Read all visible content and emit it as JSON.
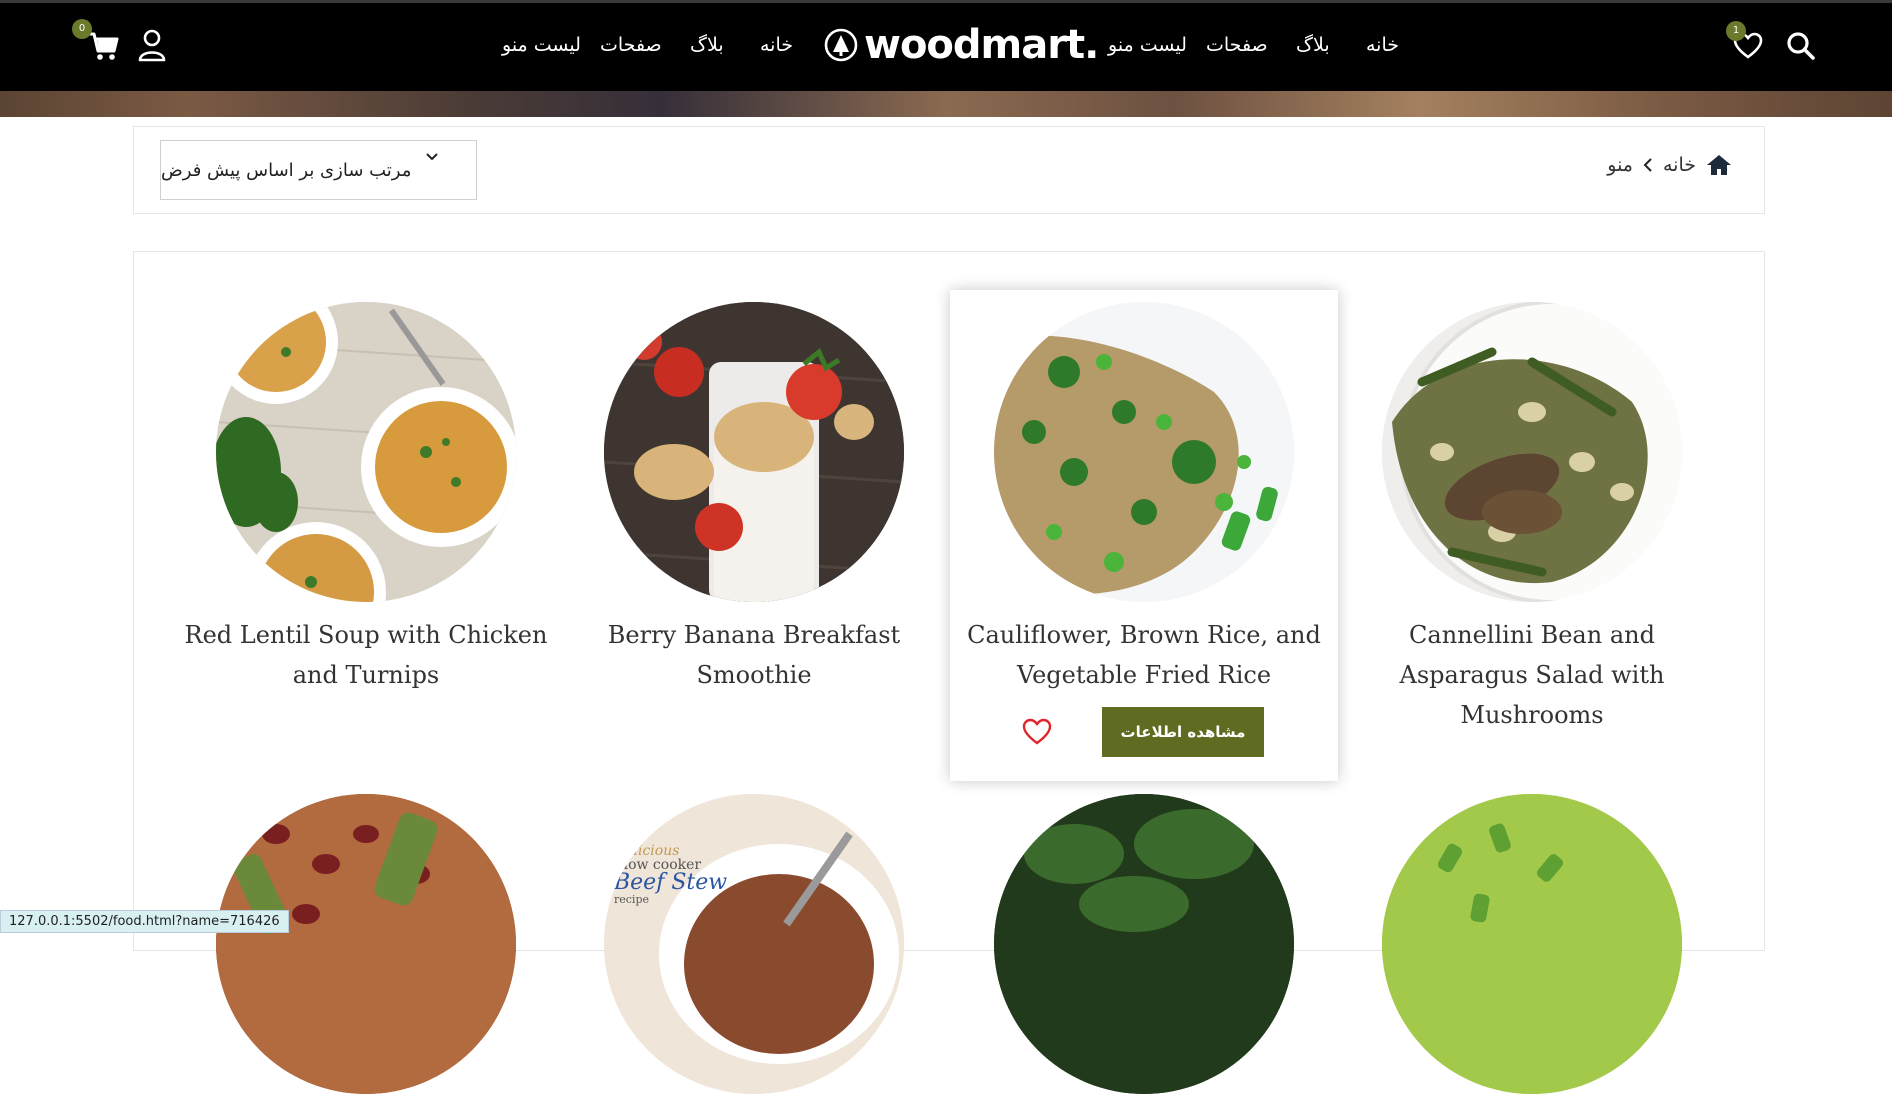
{
  "header": {
    "brand": "woodmart.",
    "nav_left": [
      "لیست منو",
      "صفحات",
      "بلاگ",
      "خانه"
    ],
    "nav_right": [
      "لیست منو",
      "صفحات",
      "بلاگ",
      "خانه"
    ],
    "cart_count": "0",
    "wishlist_count": "1"
  },
  "toolbar": {
    "sort_label": "مرتب سازی بر اساس پیش فرض",
    "breadcrumb": [
      "خانه",
      "منو"
    ]
  },
  "products": [
    {
      "title": "Red Lentil Soup with Chicken and Turnips",
      "image_icon": "lentil-soup"
    },
    {
      "title": "Berry Banana Breakfast Smoothie",
      "image_icon": "smoothie"
    },
    {
      "title": "Cauliflower, Brown Rice, and Vegetable Fried Rice",
      "image_icon": "fried-rice"
    },
    {
      "title": "Cannellini Bean and Asparagus Salad with Mushrooms",
      "image_icon": "bean-salad"
    }
  ],
  "hovered_card": {
    "button_label": "مشاهده اطلاعات"
  },
  "second_row_images": [
    "bean-stew",
    "beef-stew",
    "greens",
    "pea-soup"
  ],
  "second_row_text": [
    "Delicious",
    "Slow cooker",
    "Beef Stew",
    "recipe"
  ],
  "status_bar": {
    "url": "127.0.0.1:5502/food.html?name=716426"
  },
  "colors": {
    "accent": "#5f6b20",
    "header_bg": "#000000",
    "badge": "#6a7a2b",
    "heart": "#e0262a"
  }
}
